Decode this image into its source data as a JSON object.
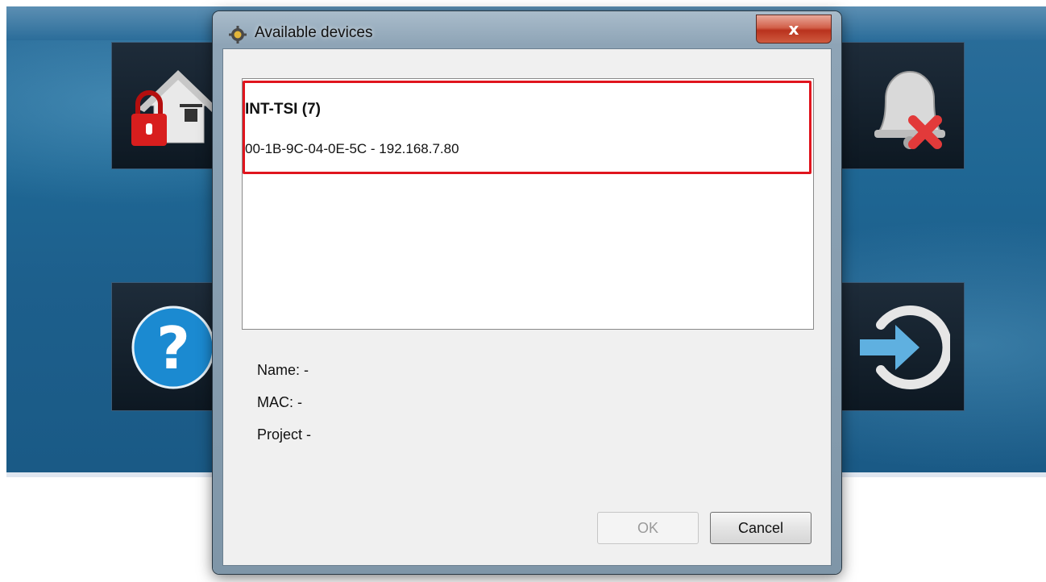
{
  "dialog": {
    "title": "Available devices",
    "close_label": "x",
    "device": {
      "name": "INT-TSI (7)",
      "address": "00-1B-9C-04-0E-5C - 192.168.7.80"
    },
    "info": {
      "name_line": "Name: -",
      "mac_line": "MAC: -",
      "project_line": "Project -"
    },
    "buttons": {
      "ok_label": "OK",
      "cancel_label": "Cancel"
    }
  },
  "background_app": {
    "tiles": [
      "house-lock-icon",
      "bell-x-icon",
      "help-icon",
      "logout-arrow-icon"
    ]
  },
  "colors": {
    "highlight": "#e0151e",
    "app_background": "#1f6794"
  }
}
